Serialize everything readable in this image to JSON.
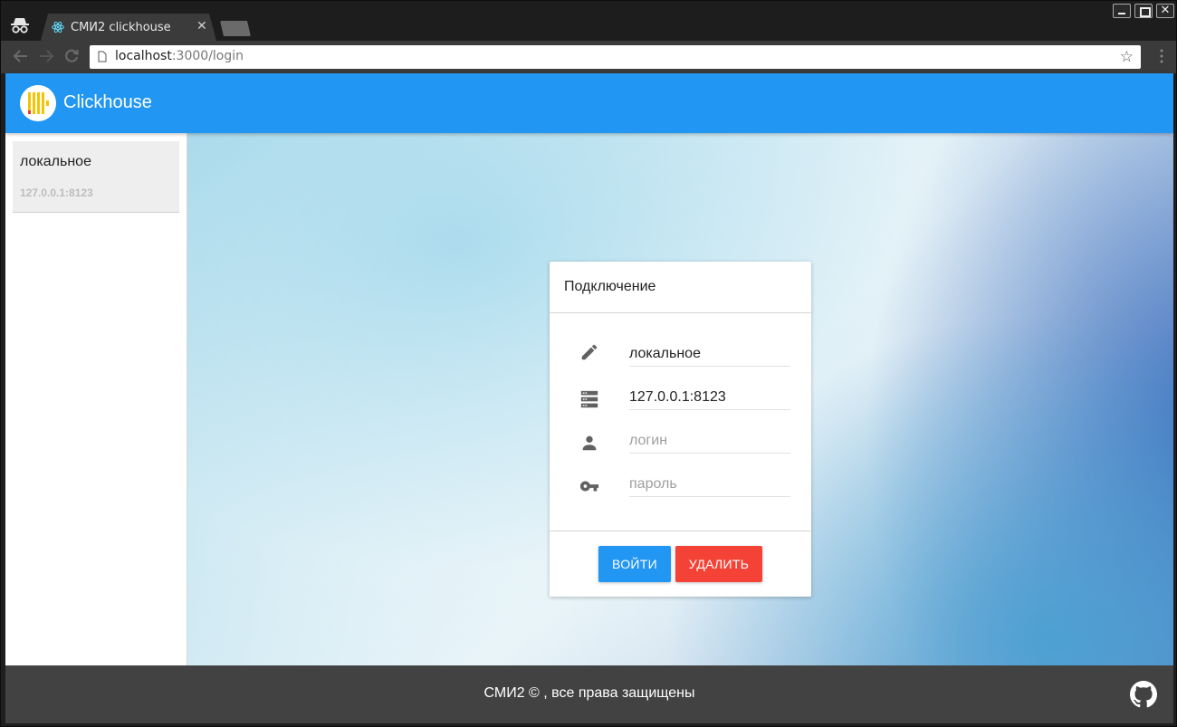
{
  "browser": {
    "tab_title": "СМИ2 clickhouse",
    "tab_close": "✕",
    "url_host": "localhost",
    "url_path": ":3000/login",
    "star_glyph": "☆",
    "window_close_glyph": "✕"
  },
  "app": {
    "title": "Clickhouse",
    "accent_color": "#2196f3"
  },
  "sidebar": {
    "connections": [
      {
        "name": "локальное",
        "host": "127.0.0.1:8123"
      }
    ]
  },
  "login_card": {
    "title": "Подключение",
    "fields": {
      "name": {
        "value": "локальное",
        "icon": "pencil-icon"
      },
      "host": {
        "value": "127.0.0.1:8123",
        "icon": "server-icon"
      },
      "login": {
        "placeholder": "логин",
        "icon": "person-icon"
      },
      "password": {
        "placeholder": "пароль",
        "icon": "key-icon"
      }
    },
    "login_button": "Войти",
    "delete_button": "Удалить",
    "login_color": "#2196f3",
    "delete_color": "#f44336"
  },
  "footer": {
    "text": "СМИ2 © , все права защищены",
    "icon": "github-icon"
  }
}
